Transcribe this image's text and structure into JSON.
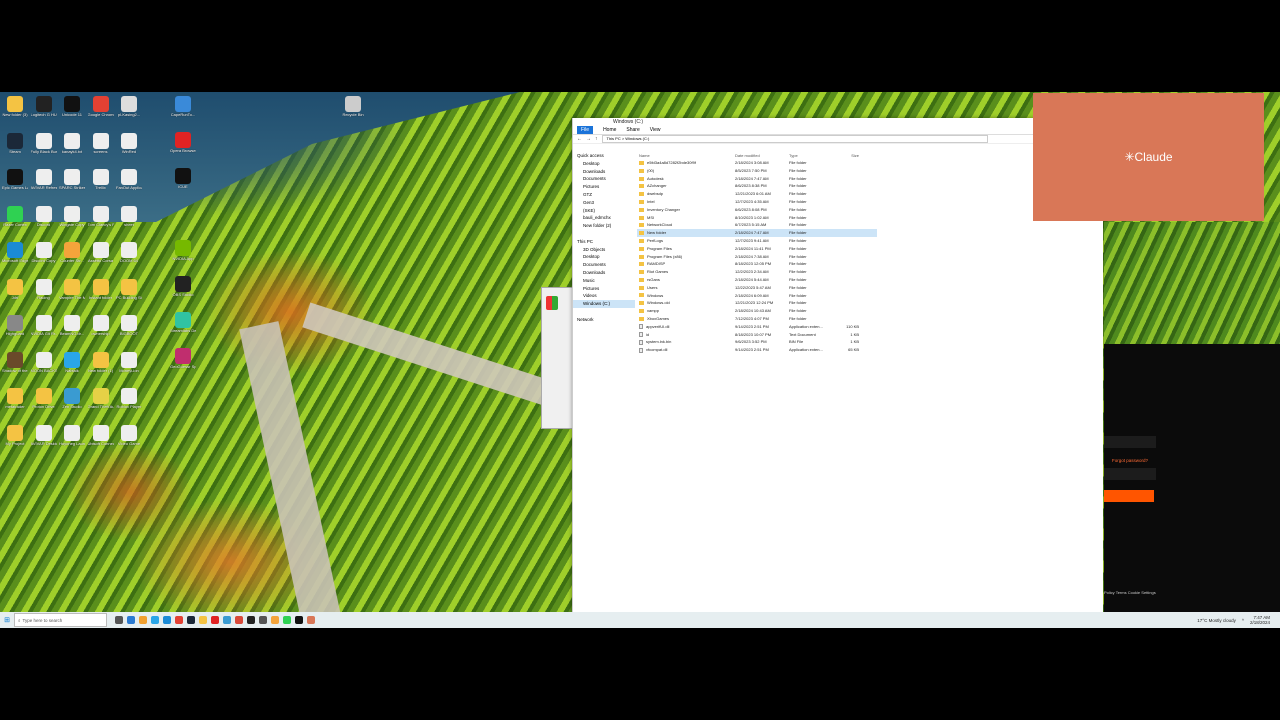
{
  "desktop": {
    "icons": [
      {
        "label": "New folder (3)",
        "color": "#f4c343"
      },
      {
        "label": "Logitech G HUB",
        "color": "#222"
      },
      {
        "label": "Unicode 11",
        "color": "#111"
      },
      {
        "label": "Google Chrome",
        "color": "#e34133"
      },
      {
        "label": "pl-Kasing2...",
        "color": "#ddd"
      },
      {
        "label": "Steam",
        "color": "#1b2838"
      },
      {
        "label": "Fully Black Burger P...",
        "color": "#eee"
      },
      {
        "label": "kanayk4.txt",
        "color": "#eee"
      },
      {
        "label": "screens",
        "color": "#eee"
      },
      {
        "label": "WinRed",
        "color": "#eee"
      },
      {
        "label": "Epic Games Launcher",
        "color": "#111"
      },
      {
        "label": "AVIVAR Refresh",
        "color": "#eee"
      },
      {
        "label": "SPARC Strikes Ta...",
        "color": "#eee"
      },
      {
        "label": "Trellix",
        "color": "#eee"
      },
      {
        "label": "FanOut Applications",
        "color": "#eee"
      },
      {
        "label": "Razer Cortex",
        "color": "#2fd152"
      },
      {
        "label": "Discord",
        "color": "#eee"
      },
      {
        "label": "Wingate Copy",
        "color": "#eee"
      },
      {
        "label": "Tom Clancy's Rainbow Six",
        "color": "#eee"
      },
      {
        "label": "sheet",
        "color": "#eee"
      },
      {
        "label": "Microsoft Edge",
        "color": "#1b8bd6"
      },
      {
        "label": "Discord Copy",
        "color": "#eee"
      },
      {
        "label": "Counter Str...",
        "color": "#f4a43b"
      },
      {
        "label": "Assetto Corsa",
        "color": "#eee"
      },
      {
        "label": "DOOM 64",
        "color": "#eee"
      },
      {
        "label": "Jdrf",
        "color": "#f4c343"
      },
      {
        "label": "Racing",
        "color": "#eee"
      },
      {
        "label": "Vampire The Masquera...",
        "color": "#f4c343"
      },
      {
        "label": "Instant folder",
        "color": "#f4c343"
      },
      {
        "label": "PC Building Simulator",
        "color": "#f4c343"
      },
      {
        "label": "Highguard",
        "color": "#888"
      },
      {
        "label": "NVIDIA Git Rr...",
        "color": "#eee"
      },
      {
        "label": "BeamNG.dr...",
        "color": "#eee"
      },
      {
        "label": "ownership",
        "color": "#eee"
      },
      {
        "label": "BIGBOOT",
        "color": "#eee"
      },
      {
        "label": "Shadow of the Tom...",
        "color": "#6a4a2a"
      },
      {
        "label": "MOON BACKS",
        "color": "#eee"
      },
      {
        "label": "Nabtalk",
        "color": "#2aa6e8"
      },
      {
        "label": "New folder (1)",
        "color": "#f4c343"
      },
      {
        "label": "MoneyLion",
        "color": "#eee"
      },
      {
        "label": "metatrader",
        "color": "#f4c343"
      },
      {
        "label": "Proton Drive",
        "color": "#f4c343"
      },
      {
        "label": "Zen Studio",
        "color": "#3a9bd1"
      },
      {
        "label": "Grand Theft Auto V En...",
        "color": "#e5d146"
      },
      {
        "label": "Roblox Player",
        "color": "#eee"
      },
      {
        "label": "My Project",
        "color": "#f4c343"
      },
      {
        "label": "AVIVAR Desktop",
        "color": "#eee"
      },
      {
        "label": "Hoyoneg Launcher",
        "color": "#eee"
      },
      {
        "label": "Ubisoft Connect",
        "color": "#eee"
      },
      {
        "label": "Video Game",
        "color": "#eee"
      }
    ],
    "right_icons": [
      {
        "label": "Recycle Bin",
        "color": "#ccc"
      },
      {
        "label": "CapeRunTo...",
        "color": "#3a8ad9"
      },
      {
        "label": "Opera Browser",
        "color": "#e02323"
      },
      {
        "label": "iCUE",
        "color": "#111"
      },
      {
        "label": "NVIDIA App",
        "color": "#76b900"
      },
      {
        "label": "OBS Studio",
        "color": "#222"
      },
      {
        "label": "Streamlabs Desktop",
        "color": "#31c3a2"
      },
      {
        "label": "GeoGuessr Speed E...",
        "color": "#c02e6e"
      }
    ]
  },
  "explorer": {
    "title": "Windows (C:)",
    "ribbon": {
      "file": "File",
      "home": "Home",
      "share": "Share",
      "view": "View"
    },
    "address": "This PC  >  Windows (C:)",
    "columns": {
      "name": "Name",
      "date": "Date modified",
      "type": "Type",
      "size": "Size"
    },
    "nav": [
      "Quick access",
      "Desktop",
      "Downloads",
      "Documents",
      "Pictures",
      "GTZ",
      "Gen3",
      "(SKE)",
      "bauli_edmchx",
      "New folder (2)",
      "",
      "This PC",
      "3D Objects",
      "Desktop",
      "Documents",
      "Downloads",
      "Music",
      "Pictures",
      "Videos",
      "Windows (C:)",
      "",
      "Network"
    ],
    "rows": [
      {
        "name": "e5fd3a4a8d7282f2bde30f9f",
        "date": "2/18/2024 3:08 AM",
        "type": "File folder",
        "size": "",
        "kind": "folder"
      },
      {
        "name": "(00)",
        "date": "8/5/2023 7:50 PM",
        "type": "File folder",
        "size": "",
        "kind": "folder"
      },
      {
        "name": "Autodesk",
        "date": "2/18/2024 7:47 AM",
        "type": "File folder",
        "size": "",
        "kind": "folder"
      },
      {
        "name": "AZchanger",
        "date": "8/6/2023 8:38 PM",
        "type": "File folder",
        "size": "",
        "kind": "folder"
      },
      {
        "name": "dwebsdp",
        "date": "12/21/2023 6:01 AM",
        "type": "File folder",
        "size": "",
        "kind": "folder"
      },
      {
        "name": "Intel",
        "date": "12/7/2023 4:35 AM",
        "type": "File folder",
        "size": "",
        "kind": "folder"
      },
      {
        "name": "Inventory Changer",
        "date": "6/6/2023 8:08 PM",
        "type": "File folder",
        "size": "",
        "kind": "folder"
      },
      {
        "name": "MSI",
        "date": "8/10/2023 1:02 AM",
        "type": "File folder",
        "size": "",
        "kind": "folder"
      },
      {
        "name": "NetworkCloud",
        "date": "6/7/2023 5:15 AM",
        "type": "File folder",
        "size": "",
        "kind": "folder"
      },
      {
        "name": "New folder",
        "date": "2/18/2024 7:47 AM",
        "type": "File folder",
        "size": "",
        "kind": "folder",
        "selected": true
      },
      {
        "name": "PerfLogs",
        "date": "12/7/2023 9:41 AM",
        "type": "File folder",
        "size": "",
        "kind": "folder"
      },
      {
        "name": "Program Files",
        "date": "2/18/2024 11:41 PM",
        "type": "File folder",
        "size": "",
        "kind": "folder"
      },
      {
        "name": "Program Files (x86)",
        "date": "2/18/2024 7:38 AM",
        "type": "File folder",
        "size": "",
        "kind": "folder"
      },
      {
        "name": "RAMDISP",
        "date": "8/18/2023 12:05 PM",
        "type": "File folder",
        "size": "",
        "kind": "folder"
      },
      {
        "name": "Riot Games",
        "date": "12/2/2023 2:34 AM",
        "type": "File folder",
        "size": "",
        "kind": "folder"
      },
      {
        "name": "rsGans",
        "date": "2/18/2024 5:44 AM",
        "type": "File folder",
        "size": "",
        "kind": "folder"
      },
      {
        "name": "Users",
        "date": "12/22/2023 5:47 AM",
        "type": "File folder",
        "size": "",
        "kind": "folder"
      },
      {
        "name": "Windows",
        "date": "2/18/2024 6:09 AM",
        "type": "File folder",
        "size": "",
        "kind": "folder"
      },
      {
        "name": "Windows.old",
        "date": "12/21/2023 12:24 PM",
        "type": "File folder",
        "size": "",
        "kind": "folder"
      },
      {
        "name": "xampp",
        "date": "2/18/2024 10:43 AM",
        "type": "File folder",
        "size": "",
        "kind": "folder"
      },
      {
        "name": "XboxGames",
        "date": "7/12/2023 4:07 PM",
        "type": "File folder",
        "size": "",
        "kind": "folder"
      },
      {
        "name": "appverifUI.dll",
        "date": "9/14/2023 2:51 PM",
        "type": "Application exten...",
        "size": "110 KB",
        "kind": "file"
      },
      {
        "name": "id",
        "date": "8/18/2023 10:07 PM",
        "type": "Text Document",
        "size": "1 KB",
        "kind": "file"
      },
      {
        "name": "system.lnk.bin",
        "date": "9/6/2023 3:52 PM",
        "type": "BIN File",
        "size": "1 KB",
        "kind": "file"
      },
      {
        "name": "vfcompat.dll",
        "date": "9/14/2023 2:51 PM",
        "type": "Application exten...",
        "size": "65 KB",
        "kind": "file"
      }
    ]
  },
  "claude_popup": {
    "label": "Claude",
    "star": "✳"
  },
  "right_panel": {
    "forgot": "Forgot password?",
    "links": "Policy   Terms   Cookie Settings"
  },
  "taskbar": {
    "search_placeholder": "Type here to search",
    "weather": "17°C  Mostly cloudy",
    "time": "7:47 AM",
    "date": "2/18/2024"
  },
  "colors": {
    "accent": "#0078d4",
    "claude": "#d97757",
    "orange_button": "#ff5500"
  }
}
